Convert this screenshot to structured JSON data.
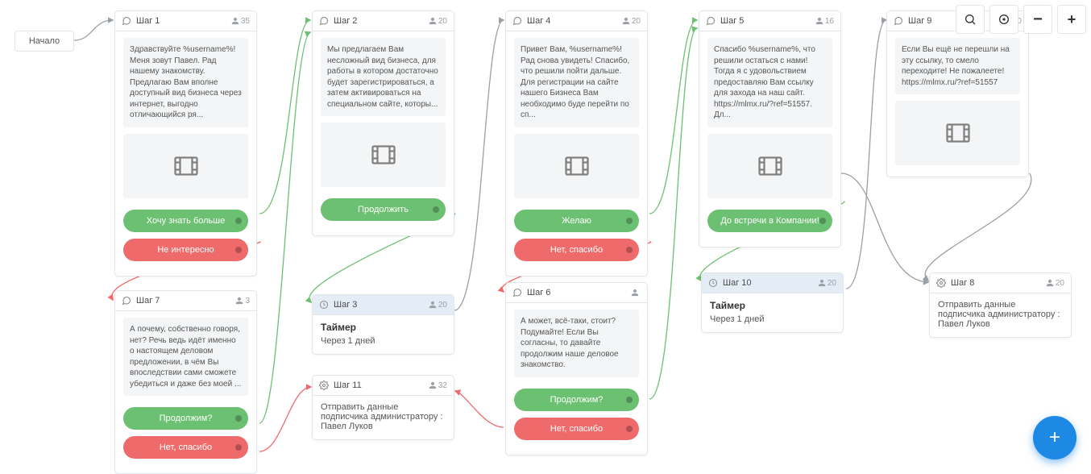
{
  "start_label": "Начало",
  "toolbar": {
    "search": "Поиск",
    "center": "Центр",
    "zoom_out": "−",
    "zoom_in": "+"
  },
  "fab": "+",
  "cards": {
    "step1": {
      "title": "Шаг 1",
      "count": "35",
      "text": "Здравствуйте %username%! Меня зовут Павел. Рад нашему знакомству. Предлагаю Вам вполне доступный вид бизнеса через интернет, выгодно отличающийся ря...",
      "btn_green": "Хочу знать больше",
      "btn_red": "Не интересно",
      "has_media": true
    },
    "step2": {
      "title": "Шаг 2",
      "count": "20",
      "text": "Мы предлагаем Вам несложный вид бизнеса, для работы в котором достаточно будет зарегистрироваться, а затем активироваться на специальном сайте, которы...",
      "btn_green": "Продолжить",
      "has_media": true
    },
    "step4": {
      "title": "Шаг 4",
      "count": "20",
      "text": "Привет Вам, %username%! Рад снова увидеть! Спасибо, что решили пойти дальше. Для регистрации на сайте нашего Бизнеса Вам необходимо буде перейти по сп...",
      "btn_green": "Желаю",
      "btn_red": "Нет, спасибо",
      "has_media": true
    },
    "step5": {
      "title": "Шаг 5",
      "count": "16",
      "text": "Спасибо %username%, что решили остаться с нами! Тогда я с удовольствием предоставляю Вам ссылку для захода на наш сайт. https://mlmx.ru/?ref=51557. Дл...",
      "btn_green": "До встречи в Компании!",
      "has_media": true
    },
    "step9": {
      "title": "Шаг 9",
      "count": "20",
      "text": "Если Вы ещё не перешли на эту ссылку, то смело переходите! Не пожалеете! https://mlmx.ru/?ref=51557",
      "has_media": true
    },
    "step7": {
      "title": "Шаг 7",
      "count": "3",
      "text": "А почему, собственно говоря, нет? Речь ведь идёт именно о настоящем деловом предложении, в чём Вы впоследствии сами сможете убедиться и даже без моей ...",
      "btn_green": "Продолжим?",
      "btn_red": "Нет, спасибо"
    },
    "step3": {
      "title": "Шаг 3",
      "count": "20",
      "timer_title": "Таймер",
      "timer_sub": "Через 1 дней"
    },
    "step11": {
      "title": "Шаг 11",
      "count": "32",
      "text": "Отправить данные подписчика администратору :\nПавел Луков"
    },
    "step6": {
      "title": "Шаг 6",
      "count": "",
      "text": "А может, всё-таки, стоит? Подумайте! Если Вы согласны, то давайте продолжим наше деловое знакомство.",
      "btn_green": "Продолжим?",
      "btn_red": "Нет, спасибо"
    },
    "step10": {
      "title": "Шаг 10",
      "count": "20",
      "timer_title": "Таймер",
      "timer_sub": "Через 1 дней"
    },
    "step8": {
      "title": "Шаг 8",
      "count": "20",
      "text": "Отправить данные подписчика администратору :\nПавел Луков"
    }
  }
}
